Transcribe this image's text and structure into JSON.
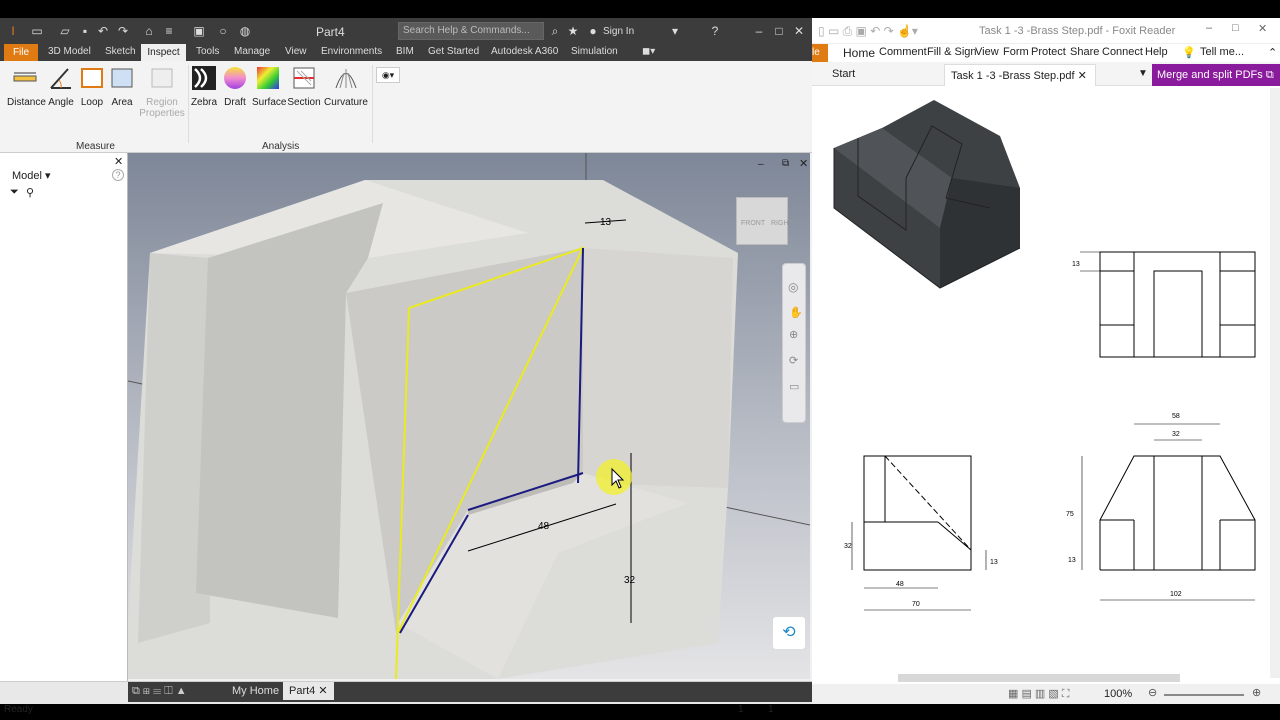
{
  "inventor": {
    "doc_title": "Part4",
    "search_placeholder": "Search Help & Commands...",
    "sign_in": "Sign In",
    "tabs": [
      "File",
      "3D Model",
      "Sketch",
      "Inspect",
      "Tools",
      "Manage",
      "View",
      "Environments",
      "BIM",
      "Get Started",
      "Autodesk A360",
      "Simulation"
    ],
    "measure_tools": [
      "Distance",
      "Angle",
      "Loop",
      "Area"
    ],
    "region_properties": [
      "Region",
      "Properties"
    ],
    "analysis_tools": [
      "Zebra",
      "Draft",
      "Surface",
      "Section",
      "Curvature"
    ],
    "group_measure": "Measure",
    "group_analysis": "Analysis",
    "browser_title": "Model",
    "viewcube": {
      "front": "FRONT",
      "right": "RIGHT"
    },
    "dimensions": {
      "top": "13",
      "width": "48",
      "height": "32"
    },
    "doc_tabs": {
      "home": "My Home",
      "part": "Part4"
    },
    "status": {
      "text": "Ready",
      "n1": "1",
      "n2": "1"
    }
  },
  "foxit": {
    "title": "Task 1 -3 -Brass Step.pdf - Foxit Reader",
    "menu": [
      "Home",
      "Comment",
      "Fill & Sign",
      "View",
      "Form",
      "Protect",
      "Share",
      "Connect",
      "Help"
    ],
    "tell_me": "Tell me...",
    "tabs": {
      "start": "Start",
      "doc": "Task 1 -3 -Brass Step.pdf"
    },
    "merge_button": "Merge and split PDFs",
    "zoom": "100%",
    "drawing": {
      "d13a": "13",
      "d32a": "32",
      "d48": "48",
      "d70": "70",
      "d13b": "13",
      "d58": "58",
      "d32b": "32",
      "d75": "75",
      "d13c": "13",
      "d102": "102"
    }
  }
}
